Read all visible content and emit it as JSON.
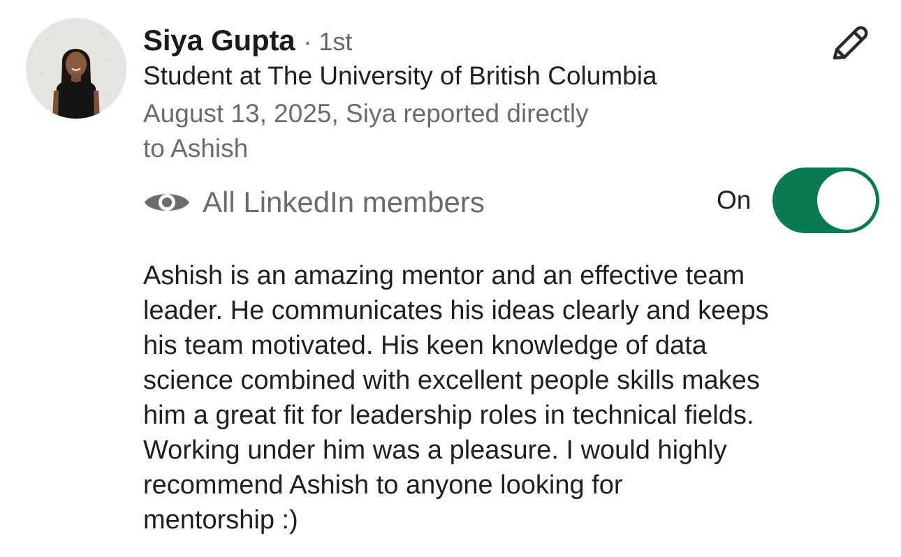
{
  "recommender": {
    "name": "Siya Gupta",
    "degree": "· 1st",
    "headline": "Student at The University of British Columbia",
    "relationship": "August 13, 2025, Siya reported directly\nto Ashish",
    "avatar_icon": "profile-photo"
  },
  "actions": {
    "edit_icon": "pencil-icon"
  },
  "visibility": {
    "icon": "eye-icon",
    "label": "All LinkedIn members",
    "toggle_label": "On",
    "toggle_state": true,
    "toggle_color": "#0a7a4f"
  },
  "recommendation": {
    "text": "Ashish is an amazing mentor and an effective team\nleader. He communicates his ideas clearly and keeps\nhis team motivated. His keen knowledge of data\nscience combined with excellent people skills makes\nhim a great fit for leadership roles in technical fields.\nWorking under him was a pleasure. I would highly\nrecommend Ashish to anyone looking for\nmentorship :)"
  }
}
